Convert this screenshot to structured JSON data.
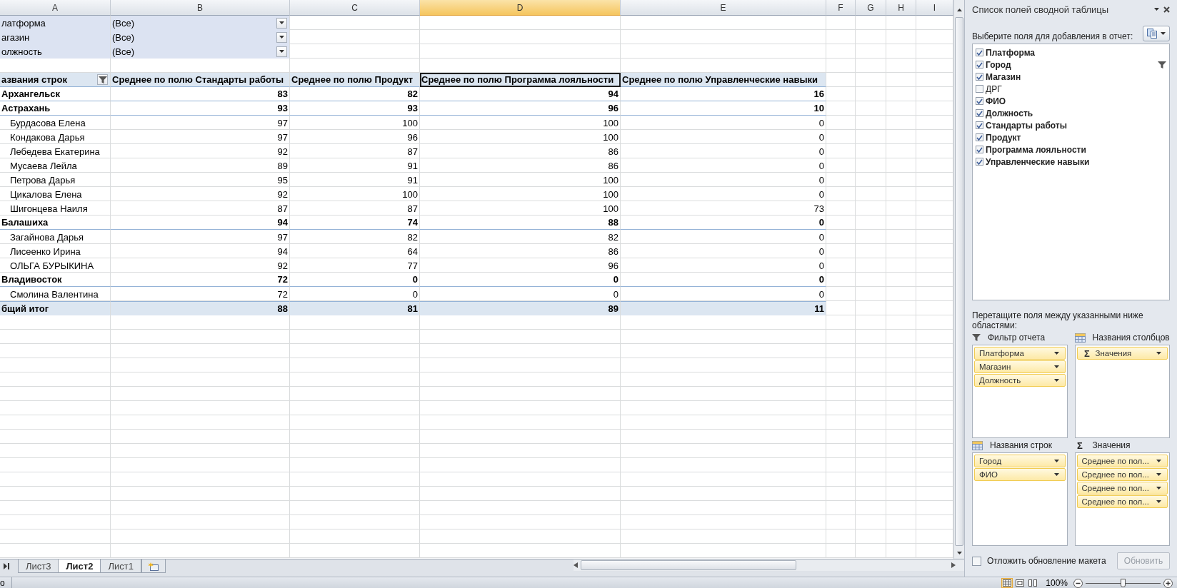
{
  "columns": [
    {
      "label": "A",
      "selected": false
    },
    {
      "label": "B",
      "selected": false
    },
    {
      "label": "C",
      "selected": false
    },
    {
      "label": "D",
      "selected": true
    },
    {
      "label": "E",
      "selected": false
    },
    {
      "label": "F",
      "selected": false
    },
    {
      "label": "G",
      "selected": false
    },
    {
      "label": "H",
      "selected": false
    },
    {
      "label": "I",
      "selected": false
    }
  ],
  "filters": [
    {
      "label": "латформа",
      "value": "(Все)"
    },
    {
      "label": "агазин",
      "value": "(Все)"
    },
    {
      "label": "олжность",
      "value": "(Все)"
    }
  ],
  "pivot": {
    "row_header": "азвания строк",
    "value_headers": [
      {
        "label": "Среднее по полю Стандарты работы",
        "selected": false
      },
      {
        "label": "Среднее по полю Продукт",
        "selected": false
      },
      {
        "label": "Среднее по полю Программа лояльности",
        "selected": true
      },
      {
        "label": "Среднее по полю Управленческие навыки",
        "selected": false
      }
    ],
    "rows": [
      {
        "kind": "group",
        "label": "Архангельск",
        "values": [
          "83",
          "82",
          "94",
          "16"
        ]
      },
      {
        "kind": "group",
        "label": "Астрахань",
        "values": [
          "93",
          "93",
          "96",
          "10"
        ]
      },
      {
        "kind": "item",
        "label": "Бурдасова Елена",
        "values": [
          "97",
          "100",
          "100",
          "0"
        ]
      },
      {
        "kind": "item",
        "label": "Кондакова Дарья",
        "values": [
          "97",
          "96",
          "100",
          "0"
        ]
      },
      {
        "kind": "item",
        "label": "Лебедева Екатерина",
        "values": [
          "92",
          "87",
          "86",
          "0"
        ]
      },
      {
        "kind": "item",
        "label": "Мусаева Лейла",
        "values": [
          "89",
          "91",
          "86",
          "0"
        ]
      },
      {
        "kind": "item",
        "label": "Петрова Дарья",
        "values": [
          "95",
          "91",
          "100",
          "0"
        ]
      },
      {
        "kind": "item",
        "label": "Цикалова Елена",
        "values": [
          "92",
          "100",
          "100",
          "0"
        ]
      },
      {
        "kind": "item",
        "label": "Шигонцева Наиля",
        "values": [
          "87",
          "87",
          "100",
          "73"
        ]
      },
      {
        "kind": "group",
        "label": "Балашиха",
        "values": [
          "94",
          "74",
          "88",
          "0"
        ]
      },
      {
        "kind": "item",
        "label": "Загайнова Дарья",
        "values": [
          "97",
          "82",
          "82",
          "0"
        ]
      },
      {
        "kind": "item",
        "label": "Лисеенко Ирина",
        "values": [
          "94",
          "64",
          "86",
          "0"
        ]
      },
      {
        "kind": "item",
        "label": "ОЛЬГА БУРЫКИНА",
        "values": [
          "92",
          "77",
          "96",
          "0"
        ]
      },
      {
        "kind": "group",
        "label": "Владивосток",
        "values": [
          "72",
          "0",
          "0",
          "0"
        ]
      },
      {
        "kind": "item",
        "label": "Смолина Валентина",
        "values": [
          "72",
          "0",
          "0",
          "0"
        ]
      }
    ],
    "total": {
      "label": "бщий итог",
      "values": [
        "88",
        "81",
        "89",
        "11"
      ]
    }
  },
  "sheet_tabs": [
    {
      "label": "Лист3",
      "selected": false
    },
    {
      "label": "Лист2",
      "selected": true
    },
    {
      "label": "Лист1",
      "selected": false
    }
  ],
  "field_list": {
    "title": "Список полей сводной таблицы",
    "prompt": "Выберите поля для добавления в отчет:",
    "fields": [
      {
        "label": "Платформа",
        "checked": true,
        "filtered": false
      },
      {
        "label": "Город",
        "checked": true,
        "filtered": true
      },
      {
        "label": "Магазин",
        "checked": true,
        "filtered": false
      },
      {
        "label": "ДРГ",
        "checked": false,
        "filtered": false
      },
      {
        "label": "ФИО",
        "checked": true,
        "filtered": false
      },
      {
        "label": "Должность",
        "checked": true,
        "filtered": false
      },
      {
        "label": "Стандарты работы",
        "checked": true,
        "filtered": false
      },
      {
        "label": "Продукт",
        "checked": true,
        "filtered": false
      },
      {
        "label": "Программа лояльности",
        "checked": true,
        "filtered": false
      },
      {
        "label": "Управленческие навыки",
        "checked": true,
        "filtered": false
      }
    ],
    "areas_hint": "Перетащите поля между указанными ниже областями:",
    "areas": [
      {
        "kind": "filter",
        "title": "Фильтр отчета",
        "items": [
          {
            "label": "Платформа"
          },
          {
            "label": "Магазин"
          },
          {
            "label": "Должность"
          }
        ]
      },
      {
        "kind": "columns",
        "title": "Названия столбцов",
        "items": [
          {
            "label": "Значения",
            "symbol": "Σ"
          }
        ]
      },
      {
        "kind": "rows",
        "title": "Названия строк",
        "items": [
          {
            "label": "Город"
          },
          {
            "label": "ФИО"
          }
        ]
      },
      {
        "kind": "values",
        "title": "Значения",
        "symbol": "Σ",
        "items": [
          {
            "label": "Среднее по пол..."
          },
          {
            "label": "Среднее по пол..."
          },
          {
            "label": "Среднее по пол..."
          },
          {
            "label": "Среднее по пол..."
          }
        ]
      }
    ],
    "defer": {
      "label": "Отложить обновление макета",
      "checked": false
    },
    "update_button": {
      "label": "Обновить",
      "disabled": true
    }
  },
  "status_bar": {
    "text": "о",
    "views": [
      {
        "kind": "normal",
        "selected": true
      },
      {
        "kind": "page-layout",
        "selected": false
      },
      {
        "kind": "page-break",
        "selected": false
      }
    ],
    "zoom": "100%",
    "zoom_slider": {
      "level": 0.5
    }
  }
}
